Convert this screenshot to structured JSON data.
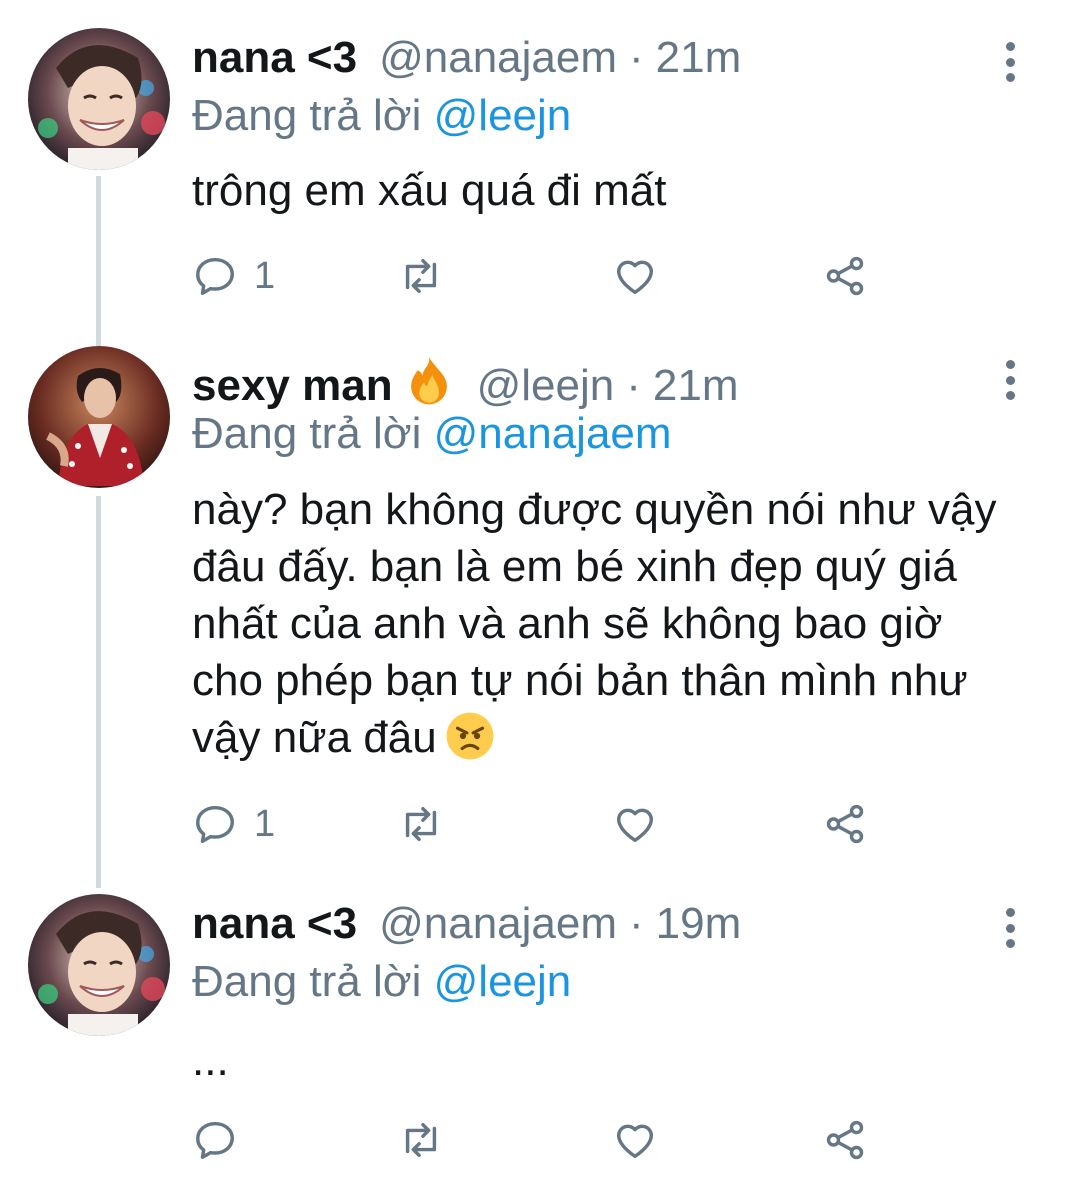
{
  "colors": {
    "text": "#14171a",
    "secondary": "#657786",
    "link": "#1b95e0",
    "thread_line": "#cfd9de"
  },
  "tweets": [
    {
      "name": "nana <3",
      "handle": "@nanajaem",
      "separator": "·",
      "time": "21m",
      "reply_prefix": "Đang trả lời",
      "reply_to": "@leejn",
      "text": "trông em xấu quá đi mất",
      "reply_count": "1",
      "avatar_icon": "profile-avatar"
    },
    {
      "name": "sexy man",
      "name_emoji": "fire-icon",
      "handle": "@leejn",
      "separator": "·",
      "time": "21m",
      "reply_prefix": "Đang trả lời",
      "reply_to": "@nanajaem",
      "text": "này? bạn không được quyền nói như vậy đâu đấy. bạn là em bé xinh đẹp quý giá nhất của anh và anh sẽ không bao giờ cho phép bạn tự nói bản thân mình như vậy nữa đâu",
      "text_emoji": "angry-face-icon",
      "reply_count": "1",
      "avatar_icon": "profile-avatar"
    },
    {
      "name": "nana <3",
      "handle": "@nanajaem",
      "separator": "·",
      "time": "19m",
      "reply_prefix": "Đang trả lời",
      "reply_to": "@leejn",
      "text": "...",
      "reply_count": "",
      "avatar_icon": "profile-avatar"
    }
  ]
}
